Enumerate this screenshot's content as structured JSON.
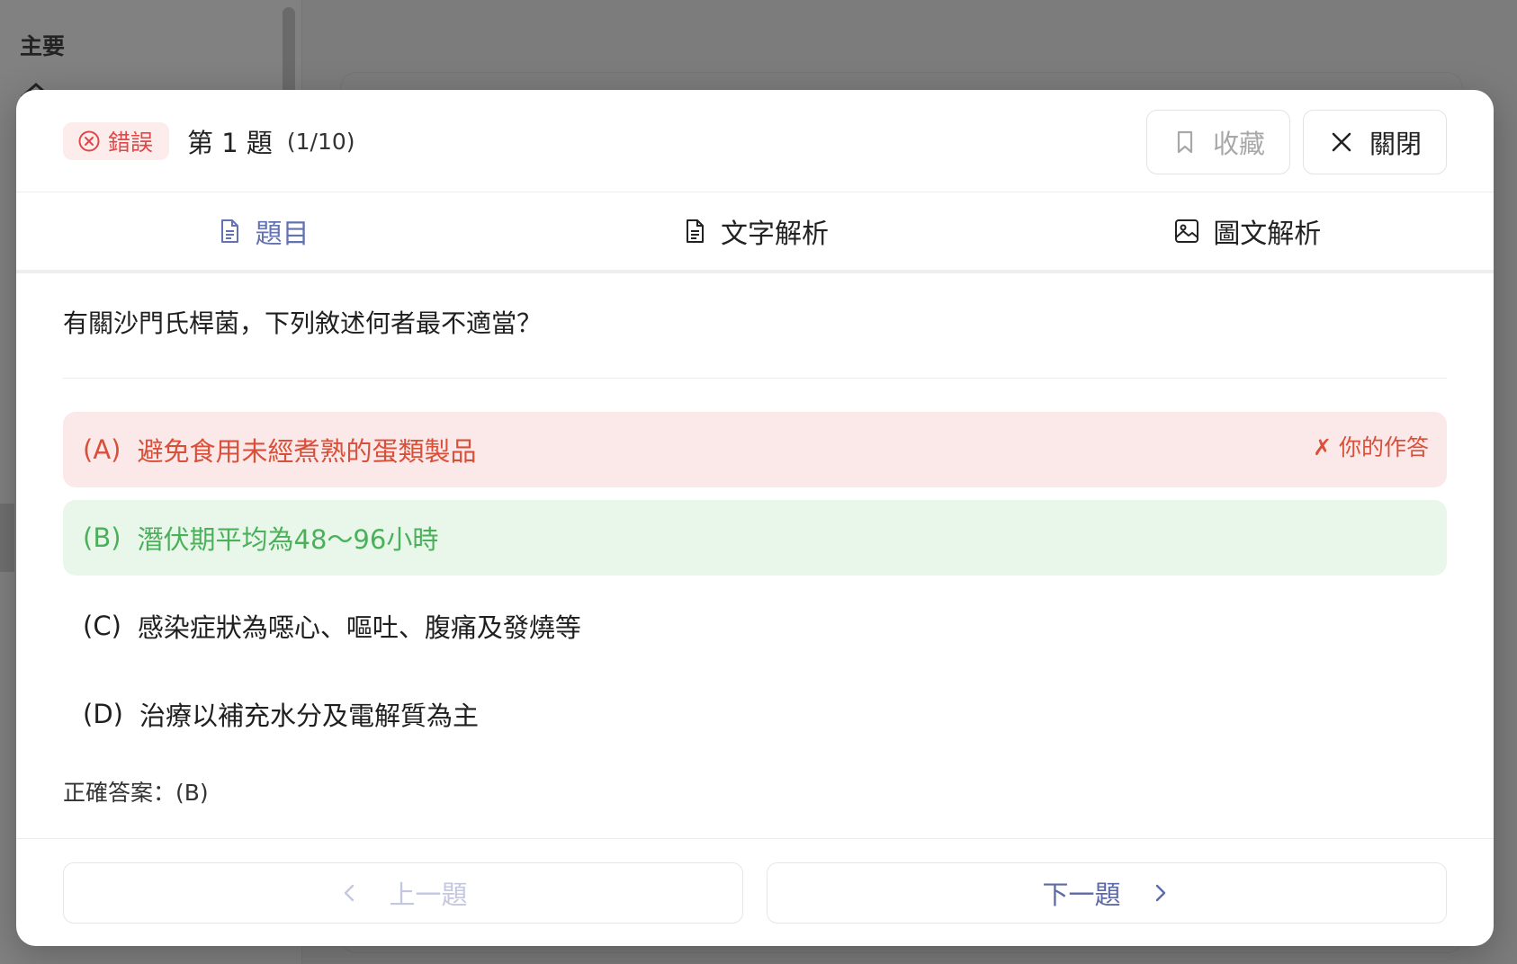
{
  "background": {
    "sidebar_section": "主要"
  },
  "header": {
    "status": "錯誤",
    "question_label": "第 1 題",
    "progress": "(1/10)",
    "bookmark_label": "收藏",
    "close_label": "關閉"
  },
  "tabs": [
    {
      "label": "題目",
      "icon": "document-icon",
      "active": true
    },
    {
      "label": "文字解析",
      "icon": "document-icon",
      "active": false
    },
    {
      "label": "圖文解析",
      "icon": "image-icon",
      "active": false
    }
  ],
  "question": {
    "text": "有關沙門氏桿菌，下列敘述何者最不適當？",
    "options": [
      {
        "letter": "(A)",
        "text": "避免食用未經煮熟的蛋類製品",
        "state": "wrong",
        "note": "✗ 你的作答"
      },
      {
        "letter": "(B)",
        "text": "潛伏期平均為48～96小時",
        "state": "correct"
      },
      {
        "letter": "(C)",
        "text": "感染症狀為噁心、嘔吐、腹痛及發燒等",
        "state": "normal"
      },
      {
        "letter": "(D)",
        "text": "治療以補充水分及電解質為主",
        "state": "normal"
      }
    ],
    "correct_answer": "正確答案：(B)"
  },
  "footer": {
    "prev_label": "上一題",
    "next_label": "下一題"
  },
  "colors": {
    "wrong": "#d9503a",
    "wrong_bg": "#fbe8e8",
    "correct": "#4bb05a",
    "correct_bg": "#e8f7ea",
    "accent": "#6372b0"
  }
}
